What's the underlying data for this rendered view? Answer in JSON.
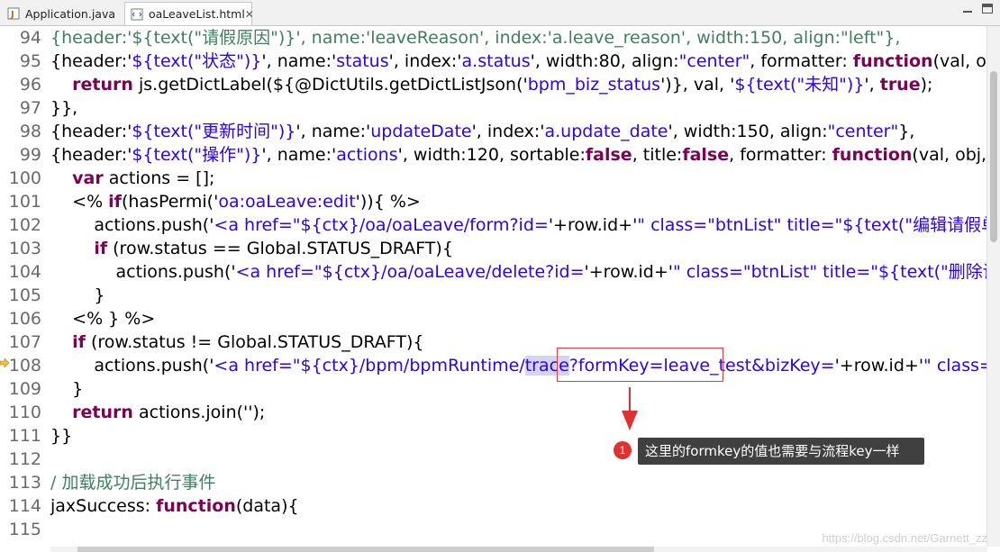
{
  "tabs": [
    {
      "label": "Application.java",
      "icon": "java-file-icon"
    },
    {
      "label": "oaLeaveList.html",
      "icon": "html-file-icon",
      "close": "✕"
    }
  ],
  "lines": [
    {
      "num": "94",
      "parts": [
        [
          "c-green",
          "{header:'${text(\"请假原因\")}', name:'leaveReason', index:'a.leave_reason', width:150, align:\"left\"},"
        ]
      ]
    },
    {
      "num": "95",
      "parts": [
        [
          "c-plain",
          "{header:'"
        ],
        [
          "c-str",
          "${text(\"状态\")}"
        ],
        [
          "c-plain",
          "', name:'"
        ],
        [
          "c-str",
          "status"
        ],
        [
          "c-plain",
          "', index:'"
        ],
        [
          "c-str",
          "a.status"
        ],
        [
          "c-plain",
          "', width:80, align:"
        ],
        [
          "c-str",
          "\"center\""
        ],
        [
          "c-plain",
          ", formatter: "
        ],
        [
          "c-kw",
          "function"
        ],
        [
          "c-plain",
          "(val, obj, row, "
        ]
      ]
    },
    {
      "num": "96",
      "parts": [
        [
          "c-plain",
          "    "
        ],
        [
          "c-kw",
          "return"
        ],
        [
          "c-plain",
          " js.getDictLabel(${@DictUtils.getDictListJson('"
        ],
        [
          "c-str",
          "bpm_biz_status"
        ],
        [
          "c-plain",
          "')}, val, '"
        ],
        [
          "c-str",
          "${text(\"未知\")}"
        ],
        [
          "c-plain",
          "', "
        ],
        [
          "c-kw",
          "true"
        ],
        [
          "c-plain",
          ");"
        ]
      ]
    },
    {
      "num": "97",
      "parts": [
        [
          "c-plain",
          "}},"
        ]
      ]
    },
    {
      "num": "98",
      "parts": [
        [
          "c-plain",
          "{header:'"
        ],
        [
          "c-str",
          "${text(\"更新时间\")}"
        ],
        [
          "c-plain",
          "', name:'"
        ],
        [
          "c-str",
          "updateDate"
        ],
        [
          "c-plain",
          "', index:'"
        ],
        [
          "c-str",
          "a.update_date"
        ],
        [
          "c-plain",
          "', width:150, align:"
        ],
        [
          "c-str",
          "\"center\""
        ],
        [
          "c-plain",
          "},"
        ]
      ]
    },
    {
      "num": "99",
      "parts": [
        [
          "c-plain",
          "{header:'"
        ],
        [
          "c-str",
          "${text(\"操作\")}"
        ],
        [
          "c-plain",
          "', name:'"
        ],
        [
          "c-str",
          "actions"
        ],
        [
          "c-plain",
          "', width:120, sortable:"
        ],
        [
          "c-kw",
          "false"
        ],
        [
          "c-plain",
          ", title:"
        ],
        [
          "c-kw",
          "false"
        ],
        [
          "c-plain",
          ", formatter: "
        ],
        [
          "c-kw",
          "function"
        ],
        [
          "c-plain",
          "(val, obj, row, act"
        ]
      ]
    },
    {
      "num": "100",
      "parts": [
        [
          "c-plain",
          "    "
        ],
        [
          "c-kw",
          "var"
        ],
        [
          "c-plain",
          " actions = [];"
        ]
      ]
    },
    {
      "num": "101",
      "parts": [
        [
          "c-plain",
          "    <% "
        ],
        [
          "c-kw",
          "if"
        ],
        [
          "c-plain",
          "(hasPermi('"
        ],
        [
          "c-str",
          "oa:oaLeave:edit"
        ],
        [
          "c-plain",
          "')){ %>"
        ]
      ]
    },
    {
      "num": "102",
      "parts": [
        [
          "c-plain",
          "        actions.push('"
        ],
        [
          "c-str",
          "<a href=\"${ctx}/oa/oaLeave/form?id="
        ],
        [
          "c-plain",
          "'+row.id+'"
        ],
        [
          "c-str",
          "\" class=\"btnList\" title=\"${text(\"编辑请假单\")}\">"
        ]
      ]
    },
    {
      "num": "103",
      "parts": [
        [
          "c-plain",
          "        "
        ],
        [
          "c-kw",
          "if"
        ],
        [
          "c-plain",
          " (row.status == Global.STATUS_DRAFT){"
        ]
      ]
    },
    {
      "num": "104",
      "parts": [
        [
          "c-plain",
          "            actions.push('"
        ],
        [
          "c-str",
          "<a href=\"${ctx}/oa/oaLeave/delete?id="
        ],
        [
          "c-plain",
          "'+row.id+'"
        ],
        [
          "c-str",
          "\" class=\"btnList\" title=\"${text(\"删除请假单\""
        ]
      ]
    },
    {
      "num": "105",
      "parts": [
        [
          "c-plain",
          "        }"
        ]
      ]
    },
    {
      "num": "106",
      "parts": [
        [
          "c-plain",
          "    <% } %>"
        ]
      ]
    },
    {
      "num": "107",
      "parts": [
        [
          "c-plain",
          "    "
        ],
        [
          "c-kw",
          "if"
        ],
        [
          "c-plain",
          " (row.status != Global.STATUS_DRAFT){"
        ]
      ]
    },
    {
      "num": "108",
      "parts": [
        [
          "c-plain",
          "        actions.push('"
        ],
        [
          "c-str",
          "<a href=\"${ctx}/bpm/bpmRuntime/"
        ],
        [
          "c-str hl",
          "trace"
        ],
        [
          "c-str",
          "?formKey=leave_test&bizKey="
        ],
        [
          "c-plain",
          "'+row.id+'"
        ],
        [
          "c-str",
          "\" class=\"btn"
        ]
      ]
    },
    {
      "num": "109",
      "parts": [
        [
          "c-plain",
          "    }"
        ]
      ]
    },
    {
      "num": "110",
      "parts": [
        [
          "c-plain",
          "    "
        ],
        [
          "c-kw",
          "return"
        ],
        [
          "c-plain",
          " actions.join('');"
        ]
      ]
    },
    {
      "num": "111",
      "parts": [
        [
          "c-plain",
          "}}"
        ]
      ]
    },
    {
      "num": "112",
      "parts": [
        [
          "c-plain",
          ""
        ]
      ]
    },
    {
      "num": "113",
      "parts": [
        [
          "c-cm",
          "/ 加载成功后执行事件"
        ]
      ]
    },
    {
      "num": "114",
      "parts": [
        [
          "c-plain",
          "jaxSuccess: "
        ],
        [
          "c-kw",
          "function"
        ],
        [
          "c-plain",
          "(data){"
        ]
      ]
    },
    {
      "num": "115",
      "parts": [
        [
          "c-plain",
          ""
        ]
      ]
    }
  ],
  "annotation": {
    "badge": "1",
    "text": "这里的formkey的值也需要与流程key一样"
  },
  "watermark": "https://blog.csdn.net/Garnett_zz"
}
